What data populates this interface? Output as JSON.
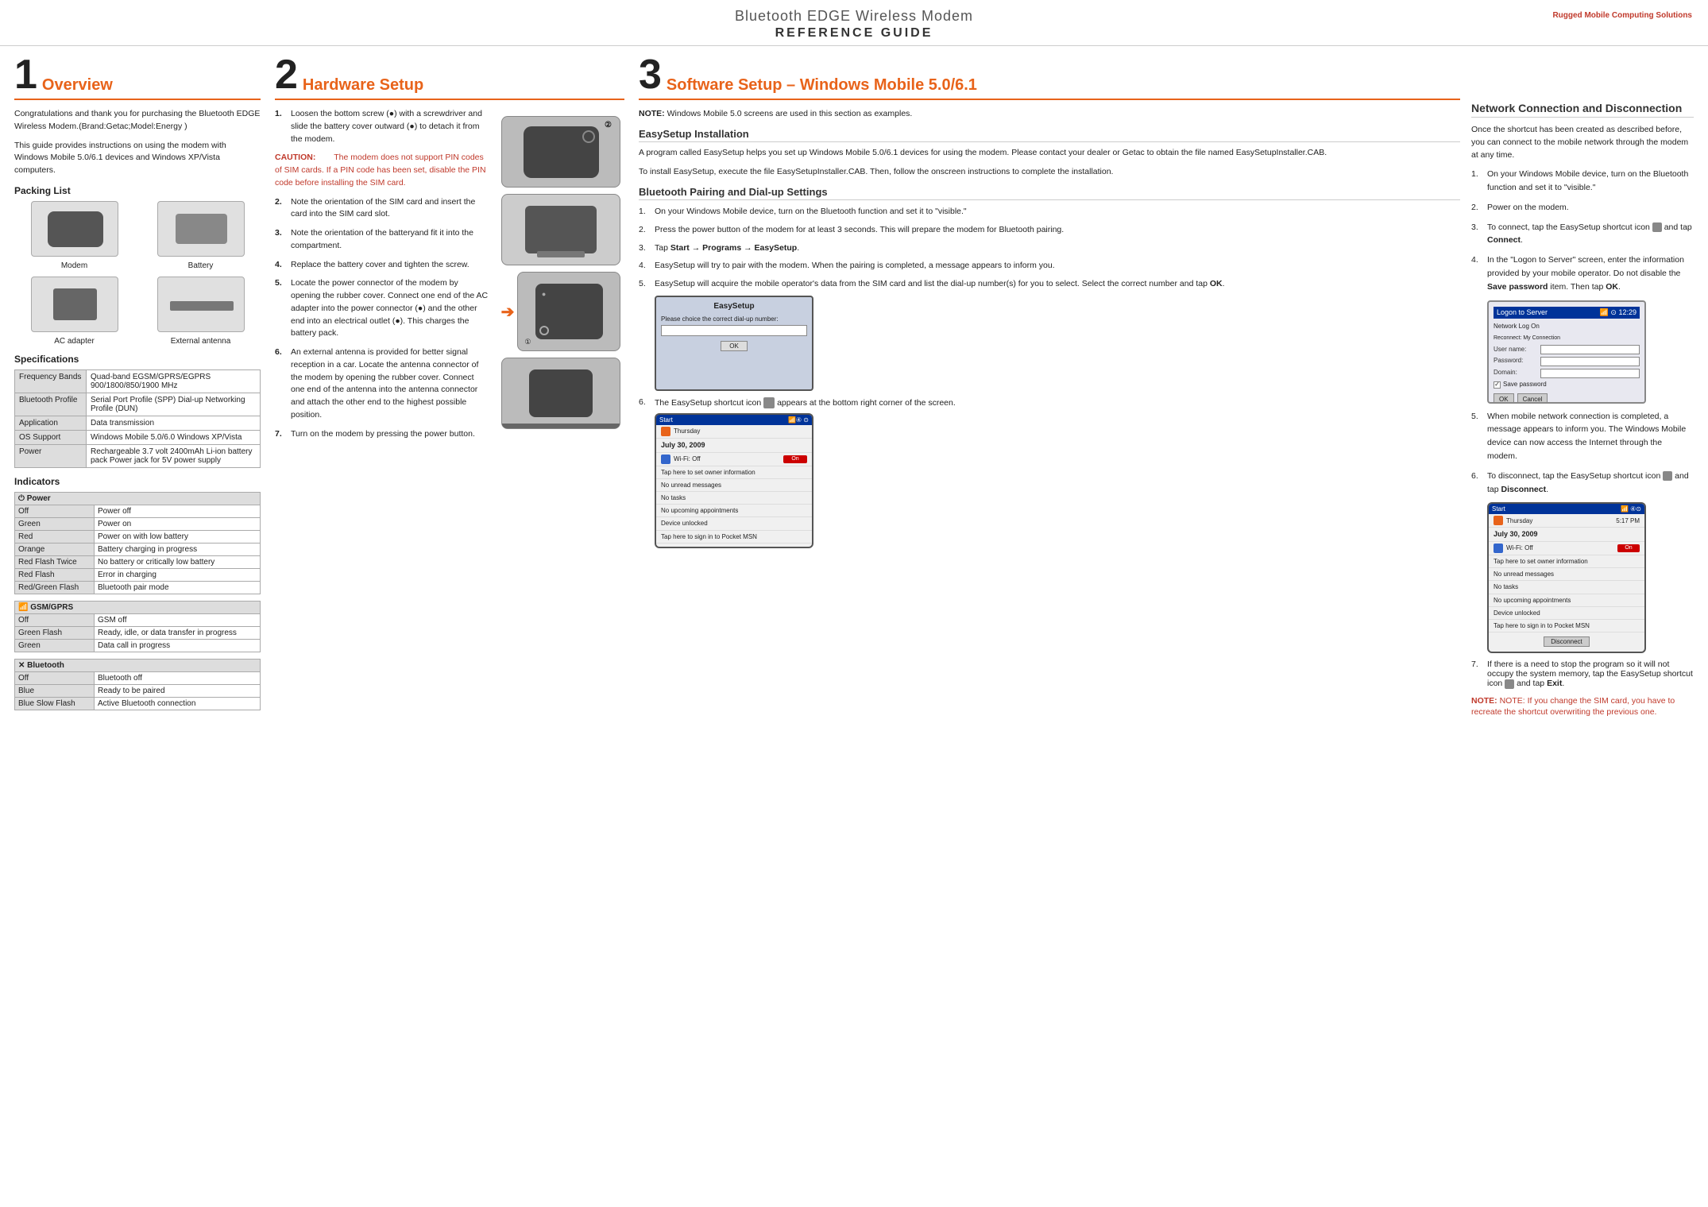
{
  "header": {
    "title": "Bluetooth EDGE Wireless Modem",
    "subtitle": "REFERENCE GUIDE",
    "brand": "Rugged Mobile Computing Solutions"
  },
  "section1": {
    "number": "1",
    "title": "Overview",
    "intro1": "Congratulations and thank you for purchasing the Bluetooth EDGE Wireless Modem.(Brand:Getac;Model:Energy )",
    "intro2": "This guide provides instructions on using the modem with Windows Mobile 5.0/6.1 devices and Windows XP/Vista computers.",
    "packing_list_title": "Packing List",
    "packing_items": [
      {
        "label": "Modem"
      },
      {
        "label": "Battery"
      },
      {
        "label": "AC adapter"
      },
      {
        "label": "External antenna"
      }
    ],
    "specs_title": "Specifications",
    "specs": [
      {
        "key": "Frequency Bands",
        "value": "Quad-band EGSM/GPRS/EGPRS 900/1800/850/1900 MHz"
      },
      {
        "key": "Bluetooth Profile",
        "value": "Serial Port Profile (SPP) Dial-up Networking Profile (DUN)"
      },
      {
        "key": "Application",
        "value": "Data transmission"
      },
      {
        "key": "OS Support",
        "value": "Windows Mobile 5.0/6.0 Windows XP/Vista"
      },
      {
        "key": "Power",
        "value": "Rechargeable 3.7 volt 2400mAh Li-ion battery pack Power jack for 5V power supply"
      }
    ],
    "indicators_title": "Indicators",
    "power_indicator_header": "Power",
    "power_indicators": [
      {
        "state": "Off",
        "meaning": "Power off"
      },
      {
        "state": "Green",
        "meaning": "Power on"
      },
      {
        "state": "Red",
        "meaning": "Power on with low battery"
      },
      {
        "state": "Orange",
        "meaning": "Battery charging in progress"
      },
      {
        "state": "Red Flash Twice",
        "meaning": "No battery or critically low battery"
      },
      {
        "state": "Red Flash",
        "meaning": "Error in charging"
      },
      {
        "state": "Red/Green Flash",
        "meaning": "Bluetooth pair mode"
      }
    ],
    "gsm_indicator_header": "GSM/GPRS",
    "gsm_indicators": [
      {
        "state": "Off",
        "meaning": "GSM off"
      },
      {
        "state": "Green Flash",
        "meaning": "Ready, idle, or data transfer in progress"
      },
      {
        "state": "Green",
        "meaning": "Data call in progress"
      }
    ],
    "bluetooth_indicator_header": "Bluetooth",
    "bluetooth_indicators": [
      {
        "state": "Off",
        "meaning": "Bluetooth off"
      },
      {
        "state": "Blue",
        "meaning": "Ready to be paired"
      },
      {
        "state": "Blue Slow Flash",
        "meaning": "Active Bluetooth connection"
      }
    ]
  },
  "section2": {
    "number": "2",
    "title": "Hardware Setup",
    "steps": [
      {
        "num": "1.",
        "text": "Loosen the bottom screw (●) with a screwdriver and slide the battery cover outward (●) to detach it from the modem."
      },
      {
        "num": "caution",
        "title": "CAUTION:",
        "text": "The modem does not support PIN codes of SIM cards. If a PIN code has been set, disable the PIN code before installing the SIM card."
      },
      {
        "num": "2.",
        "text": "Note the orientation of the SIM card and insert the card into the SIM card slot."
      },
      {
        "num": "3.",
        "text": "Note the orientation of the batteryand fit it into the compartment."
      },
      {
        "num": "4.",
        "text": "Replace the battery cover and tighten the screw."
      },
      {
        "num": "5.",
        "text": "Locate the power connector of the modem by opening the rubber cover. Connect one end of the AC adapter into the power connector (●) and the other end into an electrical outlet (●). This charges the battery pack."
      },
      {
        "num": "6.",
        "text": "An external antenna is provided for better signal reception in a car. Locate the antenna connector of the modem by opening the rubber cover. Connect one end of the antenna into the antenna connector and attach the other end to the highest possible position."
      },
      {
        "num": "7.",
        "text": "Turn on the modem by pressing the power button."
      }
    ]
  },
  "section3": {
    "number": "3",
    "title": "Software Setup – Windows Mobile 5.0/6.1",
    "note": "NOTE: Windows Mobile 5.0 screens are used in this section as examples.",
    "easysetup_title": "EasySetup Installation",
    "easysetup_steps": [
      "A program called EasySetup helps you set up Windows Mobile 5.0/6.1 devices for using the modem. Please contact your dealer or Getac to obtain the file named EasySetupInstaller.CAB.",
      "To install EasySetup, execute the file EasySetupInstaller.CAB. Then, follow the onscreen instructions to complete the installation."
    ],
    "bluetooth_title": "Bluetooth Pairing and Dial-up Settings",
    "bluetooth_steps": [
      {
        "num": "1.",
        "text": "On your Windows Mobile device, turn on the Bluetooth function and set it to \"visible.\""
      },
      {
        "num": "2.",
        "text": "Press the power button of the modem for at least 3 seconds. This will prepare the modem for Bluetooth pairing."
      },
      {
        "num": "3.",
        "text": "Tap Start → Programs → EasySetup."
      },
      {
        "num": "4.",
        "text": "EasySetup will try to pair with the modem. When the pairing is completed, a message appears to inform you."
      },
      {
        "num": "5.",
        "text": "EasySetup will acquire the mobile operator's data from the SIM card and list the dial-up number(s) for you to select. Select the correct number and tap OK."
      }
    ],
    "step6_text": "The EasySetup shortcut icon",
    "step6_text2": "appears at the bottom right corner of the screen.",
    "dialup_screen": {
      "title": "EasySetup",
      "label": "Please choice the correct dial-up number:",
      "ok": "OK"
    }
  },
  "section4": {
    "title": "Network Connection and Disconnection",
    "intro": "Once the shortcut has been created as described before, you can connect to the mobile network through the modem at any time.",
    "steps": [
      {
        "num": "1.",
        "text": "On your Windows Mobile device, turn on the Bluetooth function and set it to \"visible.\""
      },
      {
        "num": "2.",
        "text": "Power on the modem."
      },
      {
        "num": "3.",
        "text": "To connect, tap the EasySetup shortcut icon and tap Connect."
      },
      {
        "num": "4.",
        "text": "In the \"Logon to Server\" screen, enter the information provided by your mobile operator. Do not disable the Save password item. Then tap OK."
      },
      {
        "num": "5.",
        "text": "When mobile network connection is completed, a message appears to inform you. The Windows Mobile device can now access the Internet through the modem."
      },
      {
        "num": "6.",
        "text": "To disconnect, tap the EasySetup shortcut icon and tap Disconnect."
      },
      {
        "num": "7.",
        "text": "If there is a need to stop the program so it will not occupy the system memory, tap the EasySetup shortcut icon and tap Exit."
      }
    ],
    "logon_screen": {
      "title": "Logon to Server",
      "subtitle": "Network Log On",
      "fields": [
        {
          "label": "User name:",
          "value": ""
        },
        {
          "label": "Password:",
          "value": ""
        },
        {
          "label": "Domain:",
          "value": ""
        }
      ],
      "checkbox": "Save password",
      "buttons": [
        "OK",
        "Cancel"
      ]
    },
    "note": "NOTE: If you change the SIM card, you have to recreate the shortcut overwriting the previous one."
  }
}
